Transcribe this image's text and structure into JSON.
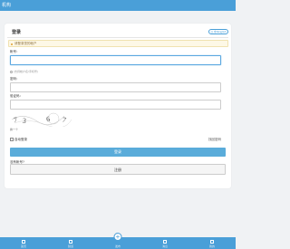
{
  "app": {
    "title": "机构"
  },
  "login": {
    "title": "登录",
    "lang_button": "◎ 中/English",
    "alert_text": "请登录您的帐户",
    "account_label": "帐号：",
    "account_value": "",
    "hint_text": "(支持帐户名/手机号)",
    "password_label": "密码：",
    "password_value": "",
    "captcha_label": "验证码：",
    "captcha_value": "",
    "captcha_chars": [
      "7",
      "3",
      "6",
      "7"
    ],
    "captcha_refresh": "换一个",
    "remember_label": "自动登录",
    "forgot_label": "找回密码",
    "login_button": "登录",
    "register_prompt": "没有帐号?",
    "register_button": "注册"
  },
  "tabbar": {
    "items": [
      {
        "label": "首页",
        "icon": "home-icon"
      },
      {
        "label": "频道",
        "icon": "grid-icon"
      },
      {
        "label": "发布",
        "icon": "plus-icon"
      },
      {
        "label": "消息",
        "icon": "message-icon"
      },
      {
        "label": "我的",
        "icon": "user-icon"
      }
    ]
  },
  "colors": {
    "accent": "#4a9fd8",
    "button": "#5aacda",
    "alert_bg": "#fdf8e6"
  }
}
